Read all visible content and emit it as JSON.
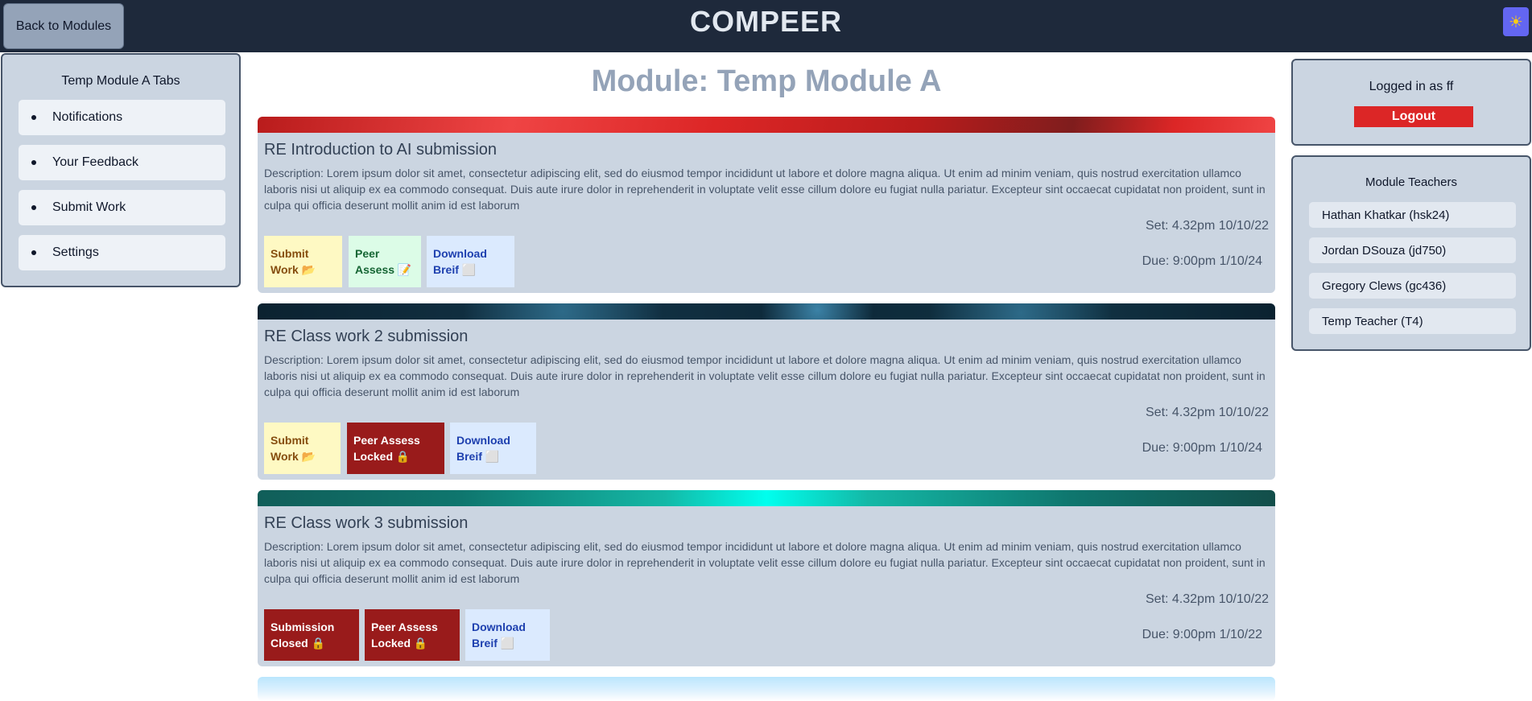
{
  "header": {
    "back_label": "Back to Modules",
    "app_title": "COMPEER",
    "theme_icon": "sun-icon"
  },
  "left_panel": {
    "title": "Temp Module A Tabs",
    "items": [
      {
        "label": "Notifications"
      },
      {
        "label": "Your Feedback"
      },
      {
        "label": "Submit Work"
      },
      {
        "label": "Settings"
      }
    ]
  },
  "main": {
    "heading": "Module: Temp Module A",
    "cards": [
      {
        "title": "RE Introduction to AI submission",
        "description": "Description: Lorem ipsum dolor sit amet, consectetur adipiscing elit, sed do eiusmod tempor incididunt ut labore et dolore magna aliqua. Ut enim ad minim veniam, quis nostrud exercitation ullamco laboris nisi ut aliquip ex ea commodo consequat. Duis aute irure dolor in reprehenderit in voluptate velit esse cillum dolore eu fugiat nulla pariatur. Excepteur sint occaecat cupidatat non proident, sunt in culpa qui officia deserunt mollit anim id est laborum",
        "set": "Set: 4.32pm 10/10/22",
        "due": "Due: 9:00pm 1/10/24",
        "buttons": [
          {
            "line1": "Submit",
            "line2": "Work 📂",
            "style": "yellow"
          },
          {
            "line1": "Peer",
            "line2": "Assess 📝",
            "style": "green"
          },
          {
            "line1": "Download",
            "line2": "Breif ⬜",
            "style": "blue"
          }
        ]
      },
      {
        "title": "RE Class work 2 submission",
        "description": "Description: Lorem ipsum dolor sit amet, consectetur adipiscing elit, sed do eiusmod tempor incididunt ut labore et dolore magna aliqua. Ut enim ad minim veniam, quis nostrud exercitation ullamco laboris nisi ut aliquip ex ea commodo consequat. Duis aute irure dolor in reprehenderit in voluptate velit esse cillum dolore eu fugiat nulla pariatur. Excepteur sint occaecat cupidatat non proident, sunt in culpa qui officia deserunt mollit anim id est laborum",
        "set": "Set: 4.32pm 10/10/22",
        "due": "Due: 9:00pm 1/10/24",
        "buttons": [
          {
            "line1": "Submit",
            "line2": "Work 📂",
            "style": "yellow"
          },
          {
            "line1": "Peer Assess",
            "line2": "Locked 🔒",
            "style": "red"
          },
          {
            "line1": "Download",
            "line2": "Breif ⬜",
            "style": "blue"
          }
        ]
      },
      {
        "title": "RE Class work 3 submission",
        "description": "Description: Lorem ipsum dolor sit amet, consectetur adipiscing elit, sed do eiusmod tempor incididunt ut labore et dolore magna aliqua. Ut enim ad minim veniam, quis nostrud exercitation ullamco laboris nisi ut aliquip ex ea commodo consequat. Duis aute irure dolor in reprehenderit in voluptate velit esse cillum dolore eu fugiat nulla pariatur. Excepteur sint occaecat cupidatat non proident, sunt in culpa qui officia deserunt mollit anim id est laborum",
        "set": "Set: 4.32pm 10/10/22",
        "due": "Due: 9:00pm 1/10/22",
        "buttons": [
          {
            "line1": "Submission",
            "line2": "Closed 🔒",
            "style": "red"
          },
          {
            "line1": "Peer Assess",
            "line2": "Locked 🔒",
            "style": "red"
          },
          {
            "line1": "Download",
            "line2": "Breif ⬜",
            "style": "blue"
          }
        ]
      }
    ]
  },
  "account": {
    "logged_in": "Logged in as ff",
    "logout_label": "Logout"
  },
  "teachers": {
    "title": "Module Teachers",
    "items": [
      {
        "name": "Hathan Khatkar (hsk24)"
      },
      {
        "name": "Jordan DSouza (jd750)"
      },
      {
        "name": "Gregory Clews (gc436)"
      },
      {
        "name": "Temp Teacher (T4)"
      }
    ]
  },
  "colors": {
    "header_bg": "#1e293b",
    "panel_bg": "#cbd5e1",
    "logout_bg": "#dc2626",
    "locked_bg": "#991b1b"
  }
}
